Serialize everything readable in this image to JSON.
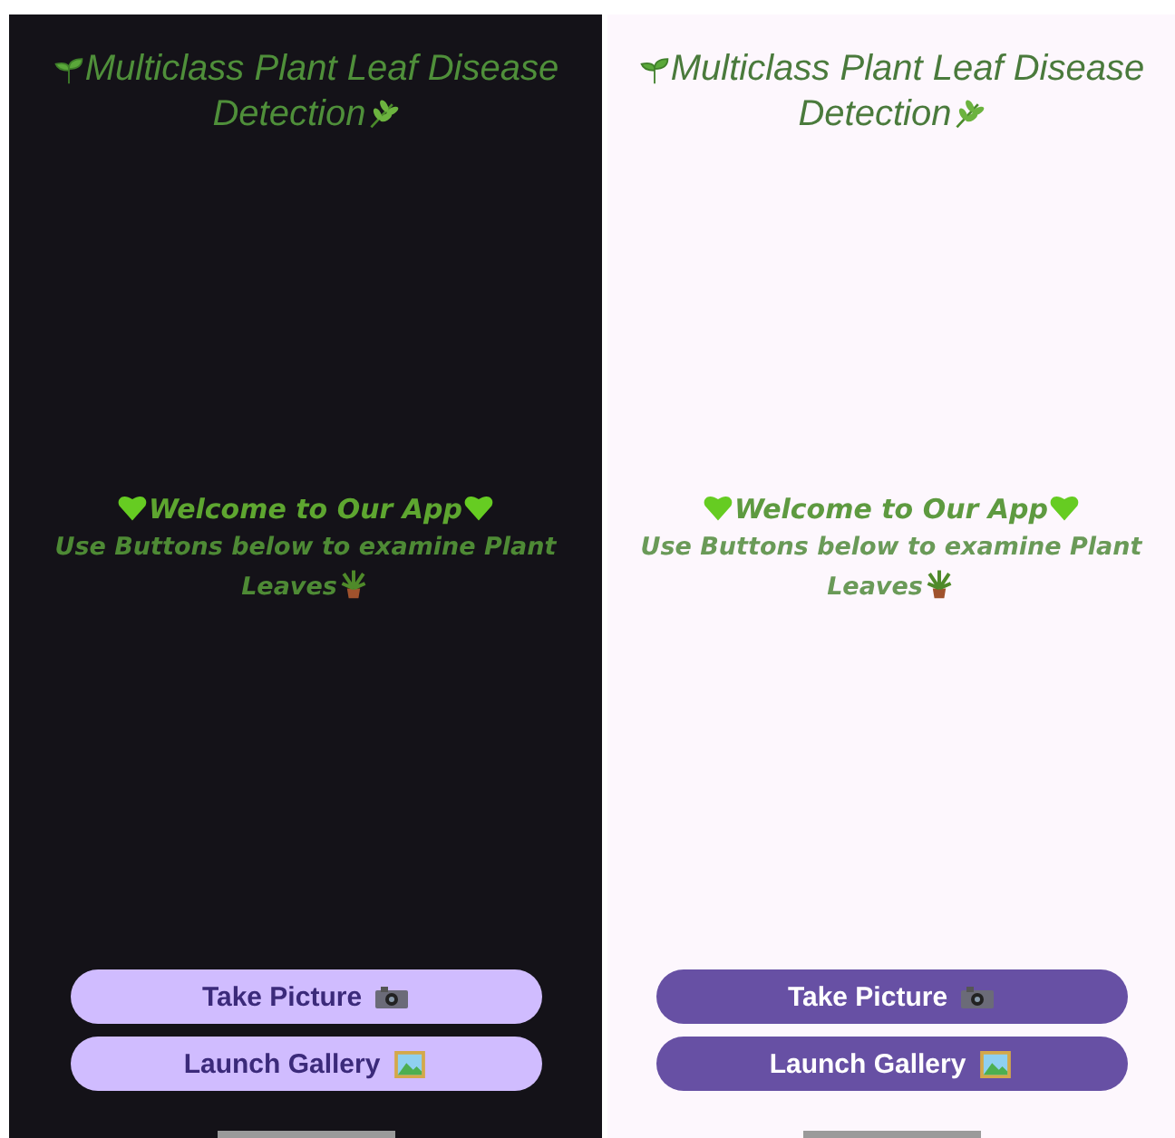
{
  "screens": [
    {
      "kind": "dark",
      "title_lines": [
        "Multiclass Plant Leaf Disease",
        "Detection"
      ],
      "welcome": "Welcome to Our App",
      "instruction_lines": [
        "Use Buttons below to examine Plant",
        "Leaves"
      ],
      "buttons": [
        {
          "label": "Take Picture",
          "kind": "camera"
        },
        {
          "label": "Launch Gallery",
          "kind": "gallery"
        }
      ]
    },
    {
      "kind": "light",
      "title_lines": [
        "Multiclass Plant Leaf Disease",
        "Detection"
      ],
      "welcome": "Welcome to Our App",
      "instruction_lines": [
        "Use Buttons below to examine Plant",
        "Leaves"
      ],
      "buttons": [
        {
          "label": "Take Picture",
          "kind": "camera"
        },
        {
          "label": "Launch Gallery",
          "kind": "gallery"
        }
      ]
    }
  ]
}
